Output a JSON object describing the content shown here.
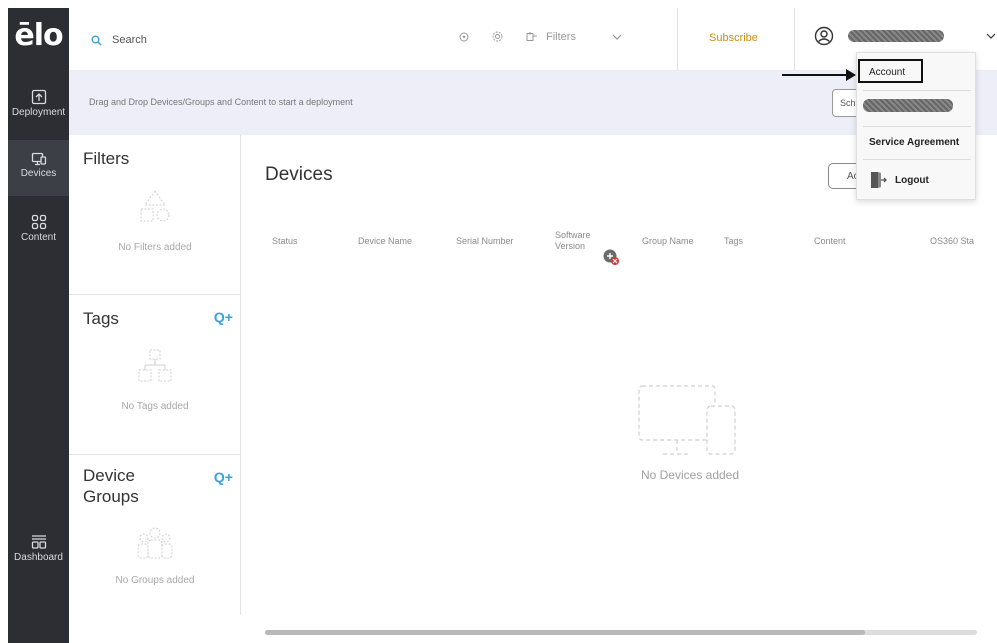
{
  "app": {
    "logo": "ēlo"
  },
  "rail": {
    "deployment": "Deployment",
    "devices": "Devices",
    "content": "Content",
    "dashboard": "Dashboard"
  },
  "topbar": {
    "search_placeholder": "Search",
    "filters_label": "Filters",
    "subscribe_label": "Subscribe"
  },
  "banner": {
    "text": "Drag and Drop Devices/Groups and Content to start a deployment",
    "schedule_button": "Sch"
  },
  "panel": {
    "filters_title": "Filters",
    "filters_empty": "No Filters added",
    "tags_title": "Tags",
    "tags_add": "Q+",
    "tags_empty": "No Tags added",
    "groups_title_line1": "Device",
    "groups_title_line2": "Groups",
    "groups_add": "Q+",
    "groups_empty": "No Groups added"
  },
  "main": {
    "title": "Devices",
    "add_button": "Ac",
    "columns": [
      "Status",
      "Device Name",
      "Serial Number",
      "Software",
      "Version",
      "Group Name",
      "Tags",
      "Content",
      "OS360 Sta"
    ],
    "empty_text": "No Devices added"
  },
  "menu": {
    "account": "Account",
    "service_agreement": "Service Agreement",
    "logout": "Logout"
  },
  "colors": {
    "rail": "#2c2e33",
    "accent": "#3aa3d8",
    "subscribe": "#d18a14",
    "banner": "#edeef8"
  }
}
